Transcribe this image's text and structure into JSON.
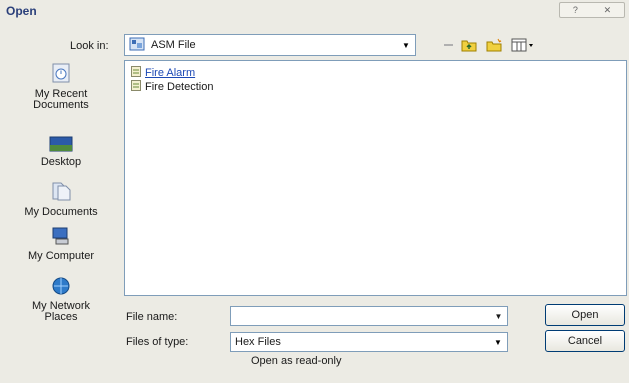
{
  "window": {
    "title": "Open"
  },
  "toolbar": {
    "look_in_label": "Look in:",
    "look_in_value": "ASM File"
  },
  "places": [
    {
      "label": "My Recent Documents",
      "icon": "recent-documents-icon"
    },
    {
      "label": "Desktop",
      "icon": "desktop-icon"
    },
    {
      "label": "My Documents",
      "icon": "my-documents-icon"
    },
    {
      "label": "My Computer",
      "icon": "my-computer-icon"
    },
    {
      "label": "My Network Places",
      "icon": "network-places-icon"
    }
  ],
  "files": [
    {
      "name": "Fire Alarm",
      "icon": "file-icon"
    },
    {
      "name": "Fire Detection",
      "icon": "file-icon"
    }
  ],
  "form": {
    "file_name_label": "File name:",
    "file_name_value": "",
    "file_type_label": "Files of type:",
    "file_type_value": "Hex Files",
    "readonly_label": "Open as read-only"
  },
  "buttons": {
    "open": "Open",
    "cancel": "Cancel"
  },
  "colors": {
    "link": "#1c49b5",
    "border": "#7f9db9",
    "face": "#ecebe4"
  }
}
